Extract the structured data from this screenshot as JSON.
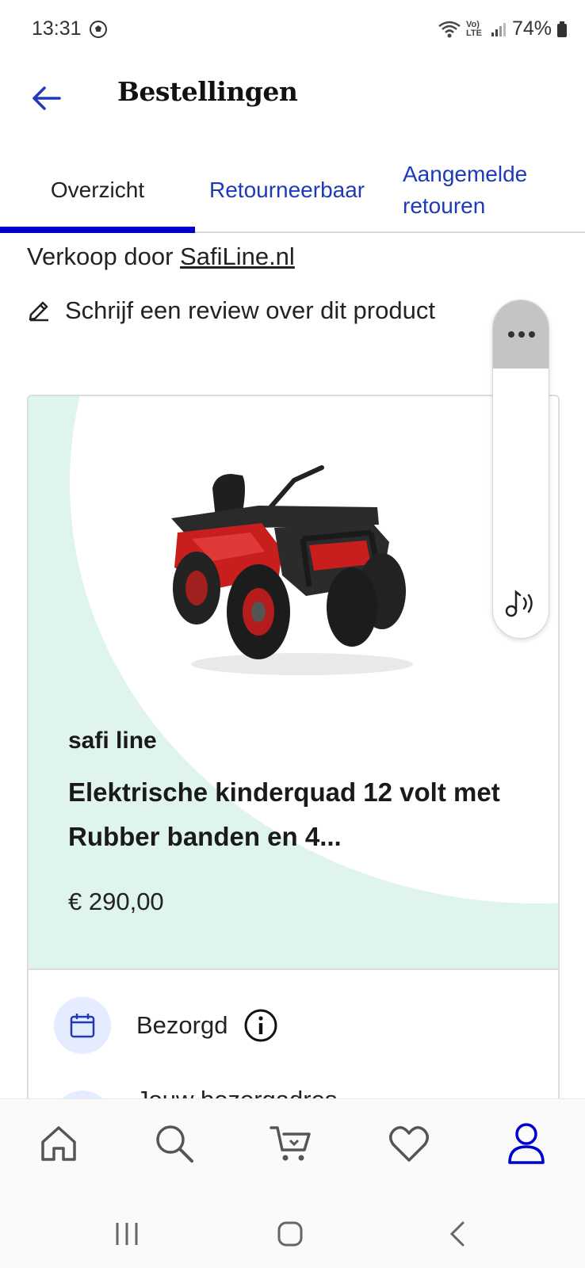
{
  "status_bar": {
    "time": "13:31",
    "network_label": "Vo) LTE",
    "battery": "74%"
  },
  "header": {
    "title": "Bestellingen",
    "back_icon": "arrow-left-icon"
  },
  "tabs": [
    {
      "label": "Overzicht",
      "active": true
    },
    {
      "label": "Retourneerbaar",
      "active": false
    },
    {
      "label": "Aangemelde retouren",
      "active": false
    }
  ],
  "seller": {
    "prefix": "Verkoop door",
    "name": "SafiLine.nl"
  },
  "review": {
    "label": "Schrijf een review over dit product",
    "icon": "pencil-icon"
  },
  "side_panel": {
    "top_icon": "more-dots-icon",
    "bottom_icon": "audio-note-icon"
  },
  "product": {
    "brand": "safi line",
    "title": "Elektrische kinderquad 12 volt met Rubber banden en 4...",
    "price": "€ 290,00",
    "image_icon": "atv-quad-product-image"
  },
  "delivery": {
    "status": "Bezorgd",
    "status_icon": "calendar-icon",
    "info_icon": "info-icon",
    "address_label": "Jouw bezorgadres"
  },
  "bottom_nav": [
    {
      "name": "home",
      "icon": "home-icon"
    },
    {
      "name": "search",
      "icon": "search-icon"
    },
    {
      "name": "cart",
      "icon": "cart-icon"
    },
    {
      "name": "wishlist",
      "icon": "heart-icon"
    },
    {
      "name": "account",
      "icon": "user-icon",
      "active": true
    }
  ],
  "system_nav": [
    "recent-apps-icon",
    "home-button-icon",
    "back-icon"
  ],
  "colors": {
    "accent": "#0000cc",
    "link": "#1f3ab8",
    "card_background": "#dff4ea",
    "icon_circle": "#e6ecff",
    "side_panel_top": "#c4c4c4"
  }
}
